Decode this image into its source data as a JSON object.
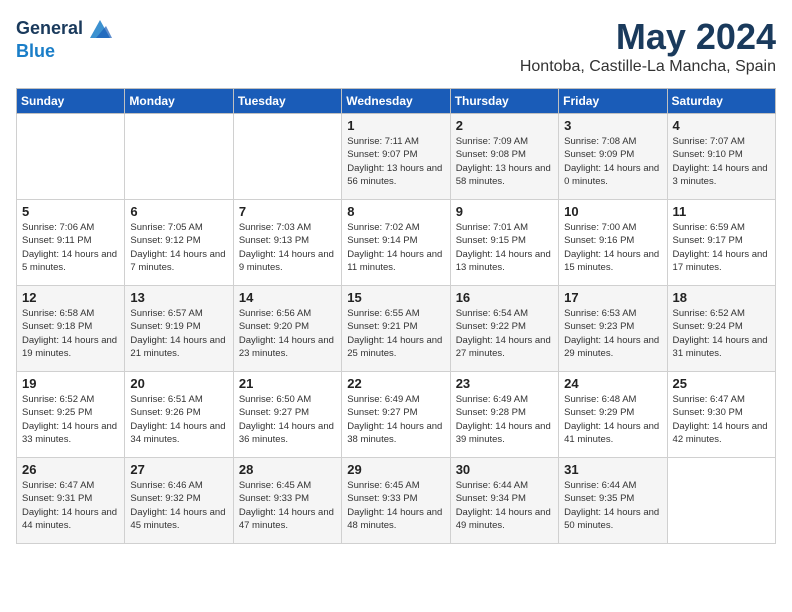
{
  "header": {
    "logo_line1": "General",
    "logo_line2": "Blue",
    "month_year": "May 2024",
    "location": "Hontoba, Castille-La Mancha, Spain"
  },
  "weekdays": [
    "Sunday",
    "Monday",
    "Tuesday",
    "Wednesday",
    "Thursday",
    "Friday",
    "Saturday"
  ],
  "weeks": [
    [
      {
        "day": "",
        "sunrise": "",
        "sunset": "",
        "daylight": ""
      },
      {
        "day": "",
        "sunrise": "",
        "sunset": "",
        "daylight": ""
      },
      {
        "day": "",
        "sunrise": "",
        "sunset": "",
        "daylight": ""
      },
      {
        "day": "1",
        "sunrise": "Sunrise: 7:11 AM",
        "sunset": "Sunset: 9:07 PM",
        "daylight": "Daylight: 13 hours and 56 minutes."
      },
      {
        "day": "2",
        "sunrise": "Sunrise: 7:09 AM",
        "sunset": "Sunset: 9:08 PM",
        "daylight": "Daylight: 13 hours and 58 minutes."
      },
      {
        "day": "3",
        "sunrise": "Sunrise: 7:08 AM",
        "sunset": "Sunset: 9:09 PM",
        "daylight": "Daylight: 14 hours and 0 minutes."
      },
      {
        "day": "4",
        "sunrise": "Sunrise: 7:07 AM",
        "sunset": "Sunset: 9:10 PM",
        "daylight": "Daylight: 14 hours and 3 minutes."
      }
    ],
    [
      {
        "day": "5",
        "sunrise": "Sunrise: 7:06 AM",
        "sunset": "Sunset: 9:11 PM",
        "daylight": "Daylight: 14 hours and 5 minutes."
      },
      {
        "day": "6",
        "sunrise": "Sunrise: 7:05 AM",
        "sunset": "Sunset: 9:12 PM",
        "daylight": "Daylight: 14 hours and 7 minutes."
      },
      {
        "day": "7",
        "sunrise": "Sunrise: 7:03 AM",
        "sunset": "Sunset: 9:13 PM",
        "daylight": "Daylight: 14 hours and 9 minutes."
      },
      {
        "day": "8",
        "sunrise": "Sunrise: 7:02 AM",
        "sunset": "Sunset: 9:14 PM",
        "daylight": "Daylight: 14 hours and 11 minutes."
      },
      {
        "day": "9",
        "sunrise": "Sunrise: 7:01 AM",
        "sunset": "Sunset: 9:15 PM",
        "daylight": "Daylight: 14 hours and 13 minutes."
      },
      {
        "day": "10",
        "sunrise": "Sunrise: 7:00 AM",
        "sunset": "Sunset: 9:16 PM",
        "daylight": "Daylight: 14 hours and 15 minutes."
      },
      {
        "day": "11",
        "sunrise": "Sunrise: 6:59 AM",
        "sunset": "Sunset: 9:17 PM",
        "daylight": "Daylight: 14 hours and 17 minutes."
      }
    ],
    [
      {
        "day": "12",
        "sunrise": "Sunrise: 6:58 AM",
        "sunset": "Sunset: 9:18 PM",
        "daylight": "Daylight: 14 hours and 19 minutes."
      },
      {
        "day": "13",
        "sunrise": "Sunrise: 6:57 AM",
        "sunset": "Sunset: 9:19 PM",
        "daylight": "Daylight: 14 hours and 21 minutes."
      },
      {
        "day": "14",
        "sunrise": "Sunrise: 6:56 AM",
        "sunset": "Sunset: 9:20 PM",
        "daylight": "Daylight: 14 hours and 23 minutes."
      },
      {
        "day": "15",
        "sunrise": "Sunrise: 6:55 AM",
        "sunset": "Sunset: 9:21 PM",
        "daylight": "Daylight: 14 hours and 25 minutes."
      },
      {
        "day": "16",
        "sunrise": "Sunrise: 6:54 AM",
        "sunset": "Sunset: 9:22 PM",
        "daylight": "Daylight: 14 hours and 27 minutes."
      },
      {
        "day": "17",
        "sunrise": "Sunrise: 6:53 AM",
        "sunset": "Sunset: 9:23 PM",
        "daylight": "Daylight: 14 hours and 29 minutes."
      },
      {
        "day": "18",
        "sunrise": "Sunrise: 6:52 AM",
        "sunset": "Sunset: 9:24 PM",
        "daylight": "Daylight: 14 hours and 31 minutes."
      }
    ],
    [
      {
        "day": "19",
        "sunrise": "Sunrise: 6:52 AM",
        "sunset": "Sunset: 9:25 PM",
        "daylight": "Daylight: 14 hours and 33 minutes."
      },
      {
        "day": "20",
        "sunrise": "Sunrise: 6:51 AM",
        "sunset": "Sunset: 9:26 PM",
        "daylight": "Daylight: 14 hours and 34 minutes."
      },
      {
        "day": "21",
        "sunrise": "Sunrise: 6:50 AM",
        "sunset": "Sunset: 9:27 PM",
        "daylight": "Daylight: 14 hours and 36 minutes."
      },
      {
        "day": "22",
        "sunrise": "Sunrise: 6:49 AM",
        "sunset": "Sunset: 9:27 PM",
        "daylight": "Daylight: 14 hours and 38 minutes."
      },
      {
        "day": "23",
        "sunrise": "Sunrise: 6:49 AM",
        "sunset": "Sunset: 9:28 PM",
        "daylight": "Daylight: 14 hours and 39 minutes."
      },
      {
        "day": "24",
        "sunrise": "Sunrise: 6:48 AM",
        "sunset": "Sunset: 9:29 PM",
        "daylight": "Daylight: 14 hours and 41 minutes."
      },
      {
        "day": "25",
        "sunrise": "Sunrise: 6:47 AM",
        "sunset": "Sunset: 9:30 PM",
        "daylight": "Daylight: 14 hours and 42 minutes."
      }
    ],
    [
      {
        "day": "26",
        "sunrise": "Sunrise: 6:47 AM",
        "sunset": "Sunset: 9:31 PM",
        "daylight": "Daylight: 14 hours and 44 minutes."
      },
      {
        "day": "27",
        "sunrise": "Sunrise: 6:46 AM",
        "sunset": "Sunset: 9:32 PM",
        "daylight": "Daylight: 14 hours and 45 minutes."
      },
      {
        "day": "28",
        "sunrise": "Sunrise: 6:45 AM",
        "sunset": "Sunset: 9:33 PM",
        "daylight": "Daylight: 14 hours and 47 minutes."
      },
      {
        "day": "29",
        "sunrise": "Sunrise: 6:45 AM",
        "sunset": "Sunset: 9:33 PM",
        "daylight": "Daylight: 14 hours and 48 minutes."
      },
      {
        "day": "30",
        "sunrise": "Sunrise: 6:44 AM",
        "sunset": "Sunset: 9:34 PM",
        "daylight": "Daylight: 14 hours and 49 minutes."
      },
      {
        "day": "31",
        "sunrise": "Sunrise: 6:44 AM",
        "sunset": "Sunset: 9:35 PM",
        "daylight": "Daylight: 14 hours and 50 minutes."
      },
      {
        "day": "",
        "sunrise": "",
        "sunset": "",
        "daylight": ""
      }
    ]
  ]
}
